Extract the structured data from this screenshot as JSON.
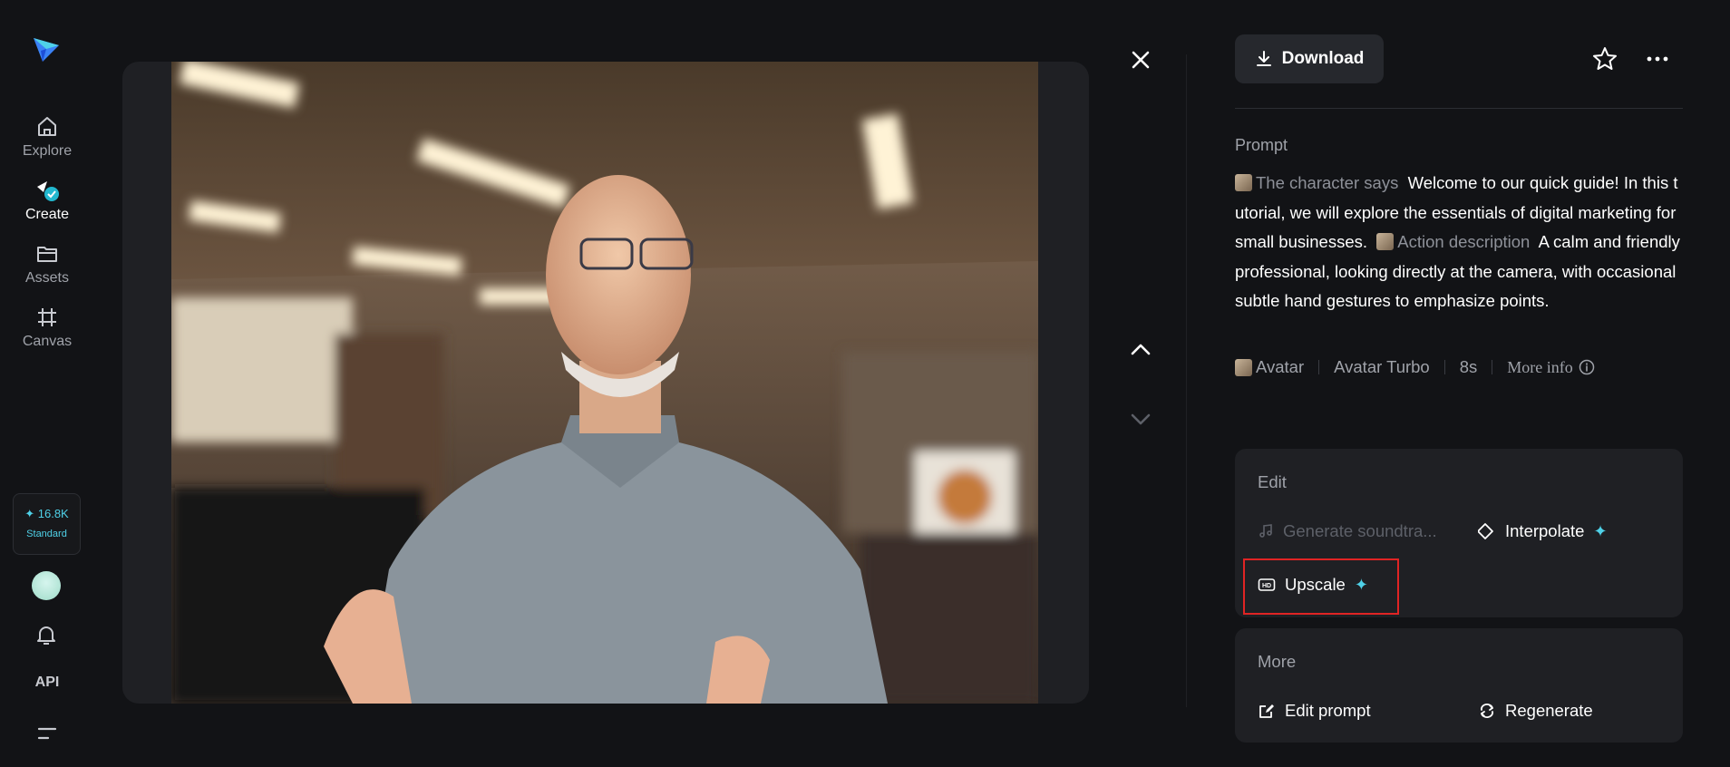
{
  "sidebar": {
    "logo": "paper-plane-logo",
    "items": [
      {
        "label": "Explore",
        "icon": "home-icon"
      },
      {
        "label": "Create",
        "icon": "create-icon"
      },
      {
        "label": "Assets",
        "icon": "folder-icon"
      },
      {
        "label": "Canvas",
        "icon": "canvas-icon"
      }
    ],
    "credits": {
      "amount": "✦ 16.8K",
      "plan": "Standard"
    },
    "api_label": "API"
  },
  "viewer": {
    "close_icon": "close-icon",
    "up_icon": "chevron-up-icon",
    "down_icon": "chevron-down-icon"
  },
  "panel": {
    "download_label": "Download",
    "prompt_title": "Prompt",
    "prompt_segments": {
      "chip1": "The character says",
      "text1": "Welcome to our quick guide! In this tutorial, we will explore the essentials of digital marketing for small businesses.",
      "chip2": "Action description",
      "text2": "A calm and friendly professional, looking directly at the camera, with occasional subtle hand gestures to emphasize points."
    },
    "meta": {
      "model": "Avatar",
      "mode": "Avatar Turbo",
      "duration": "8s",
      "more_info": "More info"
    },
    "edit": {
      "title": "Edit",
      "generate_soundtrack": "Generate soundtra...",
      "interpolate": "Interpolate",
      "upscale": "Upscale"
    },
    "more": {
      "title": "More",
      "edit_prompt": "Edit prompt",
      "regenerate": "Regenerate"
    }
  },
  "colors": {
    "accent": "#4fd1e8",
    "background": "#121316",
    "card": "#1f2024",
    "highlight": "#e02424"
  }
}
